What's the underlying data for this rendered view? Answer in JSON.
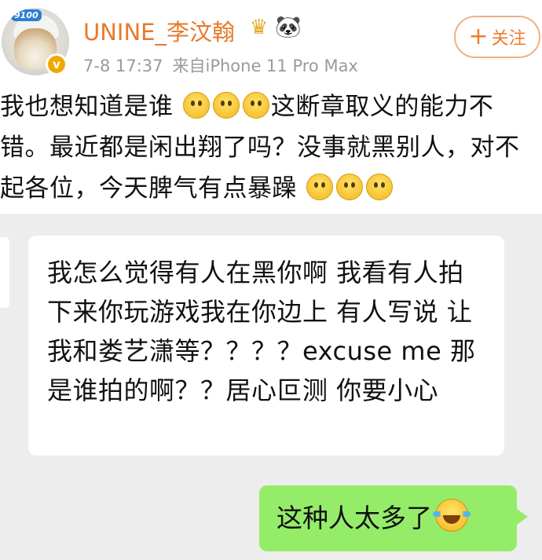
{
  "post": {
    "avatar_tag": "9100",
    "verified_mark": "v",
    "username": "UNINE_李汶翰",
    "crown_icon": "♛",
    "panda_icon": "🐼",
    "time": "7-8 17:37",
    "source": "来自iPhone 11 Pro Max",
    "follow_plus": "+",
    "follow_label": "关注",
    "text_1": "我也想知道是谁",
    "text_2": "这断章取义的能力不错。最近都是闲出翔了吗？没事就黑别人，对不起各位，今天脾气有点暴躁",
    "emoji_icon": "smile-emoji-icon"
  },
  "chat": {
    "incoming_message": "我怎么觉得有人在黑你啊 我看有人拍下来你玩游戏我在你边上 有人写说 让我和娄艺潇等？？？？excuse me 那是谁拍的啊？？居心叵测 你要小心",
    "outgoing_message": "这种人太多了",
    "laugh_icon": "tears-of-joy-emoji-icon"
  },
  "colors": {
    "username": "#e8792c",
    "follow_border": "#f0b083",
    "chat_background": "#ededed",
    "outgoing_bubble": "#95ec69"
  }
}
